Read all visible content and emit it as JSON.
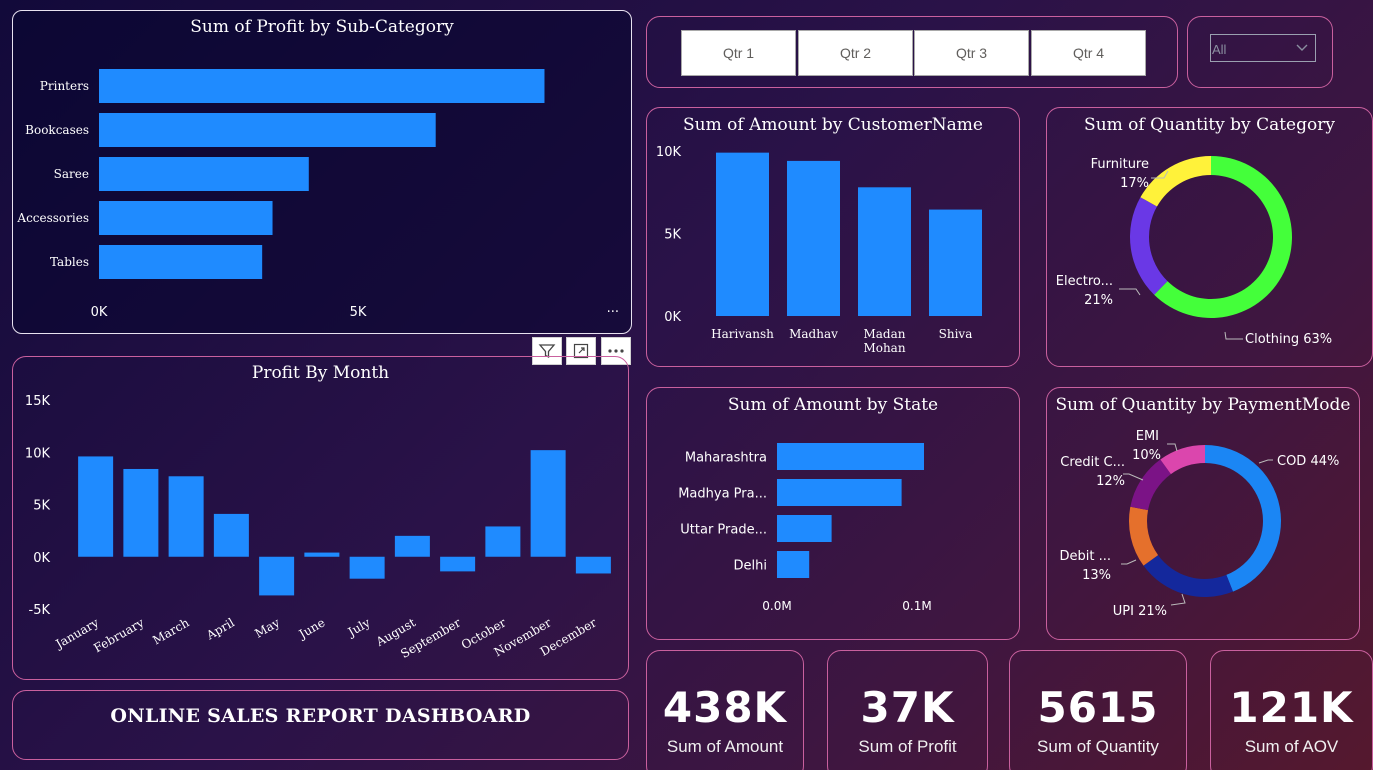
{
  "colors": {
    "bar": "#1f8bff",
    "panel_border": "#c9609e",
    "donut_clothing": "#44ff3a",
    "donut_electronics": "#6a38e6",
    "donut_furniture": "#fff23a",
    "pay_cod": "#1b86f4",
    "pay_upi": "#14289c",
    "pay_debit": "#e5702c",
    "pay_credit": "#7b1386",
    "pay_emi": "#db46ad"
  },
  "more_dots": "...",
  "slicer": {
    "quarters": [
      "Qtr 1",
      "Qtr 2",
      "Qtr 3",
      "Qtr 4"
    ],
    "dropdown_value": "All",
    "dropdown_icon": "chevron-down-icon"
  },
  "visual_toolbar": {
    "icons": [
      "filter-icon",
      "focus-mode-icon",
      "more-options-icon"
    ]
  },
  "dashboard_title": "ONLINE SALES REPORT DASHBOARD",
  "kpis": [
    {
      "value": "438K",
      "label": "Sum of Amount"
    },
    {
      "value": "37K",
      "label": "Sum of Profit"
    },
    {
      "value": "5615",
      "label": "Sum of Quantity"
    },
    {
      "value": "121K",
      "label": "Sum of AOV"
    }
  ],
  "chart_data": [
    {
      "id": "profit_by_subcategory",
      "type": "bar",
      "orientation": "horizontal",
      "title": "Sum of Profit by Sub-Category",
      "categories": [
        "Printers",
        "Bookcases",
        "Saree",
        "Accessories",
        "Tables"
      ],
      "values": [
        8600,
        6500,
        4050,
        3350,
        3150
      ],
      "xlim": [
        0,
        10000
      ],
      "x_ticks": [
        "0K",
        "5K"
      ],
      "grid": false
    },
    {
      "id": "profit_by_month",
      "type": "bar",
      "title": "Profit By Month",
      "categories": [
        "January",
        "February",
        "March",
        "April",
        "May",
        "June",
        "July",
        "August",
        "September",
        "October",
        "November",
        "December"
      ],
      "values": [
        9600,
        8400,
        7700,
        4100,
        -3700,
        400,
        -2100,
        2000,
        -1400,
        2900,
        10200,
        -1600
      ],
      "ylim": [
        -5000,
        15000
      ],
      "y_ticks": [
        "15K",
        "10K",
        "5K",
        "0K",
        "-5K"
      ],
      "grid": false
    },
    {
      "id": "amount_by_customer",
      "type": "bar",
      "title": "Sum of Amount by CustomerName",
      "categories": [
        "Harivansh",
        "Madhav",
        "Madan Mohan",
        "Shiva"
      ],
      "values": [
        9900,
        9400,
        7800,
        6450
      ],
      "ylim": [
        0,
        10000
      ],
      "y_ticks": [
        "10K",
        "5K",
        "0K"
      ],
      "grid": false
    },
    {
      "id": "quantity_by_category",
      "type": "pie",
      "style": "donut",
      "title": "Sum of Quantity by Category",
      "slices": [
        {
          "label": "Clothing",
          "value": 63,
          "label_text": "Clothing 63%"
        },
        {
          "label": "Electro...",
          "value": 21,
          "label_text": "21%"
        },
        {
          "label": "Furniture",
          "value": 17,
          "label_text": "17%"
        }
      ]
    },
    {
      "id": "amount_by_state",
      "type": "bar",
      "orientation": "horizontal",
      "title": "Sum of Amount by State",
      "categories": [
        "Maharashtra",
        "Madhya Pra...",
        "Uttar Prade...",
        "Delhi"
      ],
      "values": [
        0.105,
        0.089,
        0.039,
        0.023
      ],
      "xlim": [
        0,
        0.14
      ],
      "x_ticks": [
        "0.0M",
        "0.1M"
      ],
      "grid": false
    },
    {
      "id": "quantity_by_paymentmode",
      "type": "pie",
      "style": "donut",
      "title": "Sum of Quantity by PaymentMode",
      "slices": [
        {
          "label": "COD",
          "value": 44,
          "label_text": "COD 44%"
        },
        {
          "label": "UPI",
          "value": 21,
          "label_text": "UPI 21%"
        },
        {
          "label": "Debit ...",
          "value": 13,
          "label_text": "13%"
        },
        {
          "label": "Credit C...",
          "value": 12,
          "label_text": "12%"
        },
        {
          "label": "EMI",
          "value": 10,
          "label_text": "10%"
        }
      ]
    }
  ]
}
